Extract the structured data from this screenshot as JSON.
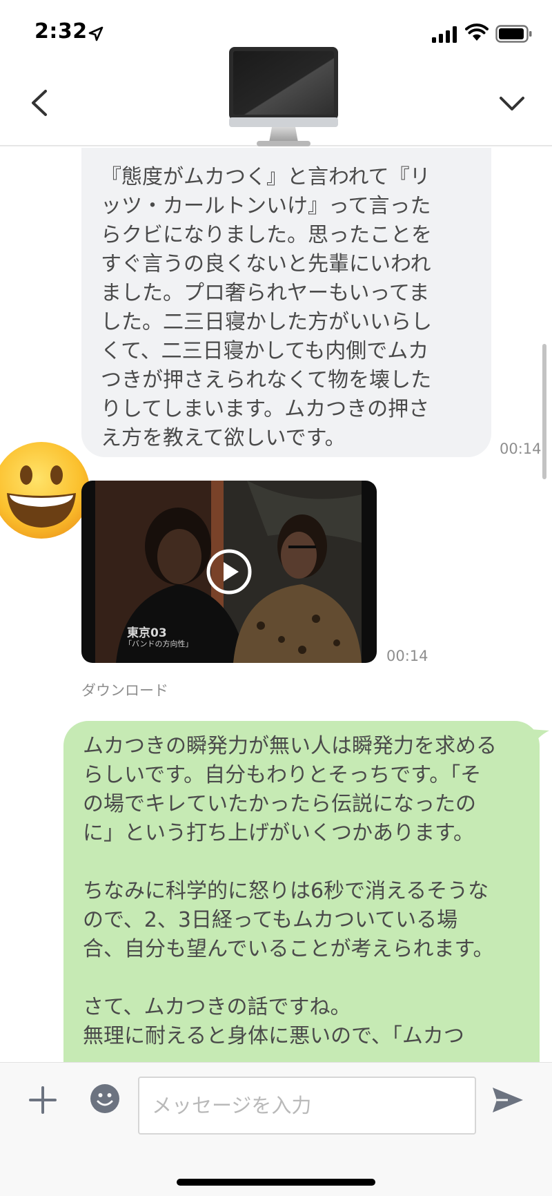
{
  "status_bar": {
    "time": "2:32"
  },
  "header": {
    "back_icon": "chevron-left-icon",
    "menu_icon": "chevron-down-icon",
    "avatar_icon": "desktop-computer-icon"
  },
  "messages": {
    "incoming_text": {
      "lines": [
        "『態度がムカつく』と言われて『リ",
        "ッツ・カールトンいけ』って言った",
        "らクビになりました。思ったことを",
        "すぐ言うの良くないと先輩にいわれ",
        "ました。プロ奢られヤーもいってま",
        "した。二三日寝かした方がいいらし",
        "くて、二三日寝かしても内側でムカ",
        "つきが押さえられなくて物を壊した",
        "りしてしまいます。ムカつきの押さ",
        "え方を教えて欲しいです。"
      ],
      "time": "00:14"
    },
    "incoming_video": {
      "caption_overlay": "東京03",
      "caption_sub": "「バンドの方向性」",
      "time": "00:14",
      "download_label": "ダウンロード"
    },
    "outgoing_text": {
      "paragraph1": [
        "ムカつきの瞬発力が無い人は瞬発力を求める",
        "らしいです。自分もわりとそっちです。「そ",
        "の場でキレていたかったら伝説になったの",
        "に」という打ち上げがいくつかあります。"
      ],
      "paragraph2": [
        "ちなみに科学的に怒りは6秒で消えるそうな",
        "ので、2、3日経ってもムカついている場",
        "合、自分も望んでいることが考えられます。"
      ],
      "paragraph3": [
        "さて、ムカつきの話ですね。",
        "無理に耐えると身体に悪いので、「ムカつ"
      ]
    }
  },
  "input_bar": {
    "placeholder": "メッセージを入力",
    "value": ""
  },
  "colors": {
    "incoming_bubble": "#f1f2f4",
    "outgoing_bubble": "#c6eab4",
    "timestamp": "#8e8e8e",
    "icon_gray": "#6c7380"
  }
}
